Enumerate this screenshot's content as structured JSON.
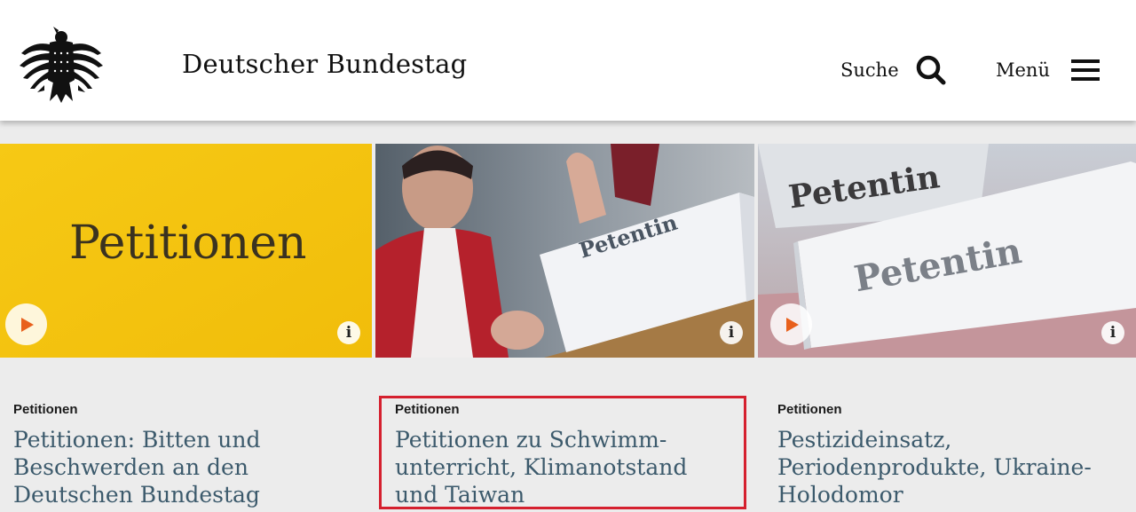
{
  "header": {
    "site_title": "Deutscher Bundestag",
    "search_label": "Suche",
    "menu_label": "Menü"
  },
  "cards": [
    {
      "image_text": "Petitionen",
      "category": "Petitionen",
      "title": "Petitionen: Bitten und Beschwerden an den Deutschen Bundestag",
      "has_play": true
    },
    {
      "image_text": "Petentin",
      "category": "Petitionen",
      "title": "Petitionen zu Schwimm-unterricht, Klimanotstand und Taiwan",
      "has_play": false
    },
    {
      "image_text_back": "Petentin",
      "image_text_front": "Petentin",
      "category": "Petitionen",
      "title": "Pestizideinsatz, Periodenprodukte, Ukraine-Holodomor",
      "has_play": true
    }
  ],
  "colors": {
    "accent_title": "#3c5a6c",
    "highlight": "#d5202e",
    "play_icon": "#e8601c",
    "card_bg": "#ececec"
  }
}
